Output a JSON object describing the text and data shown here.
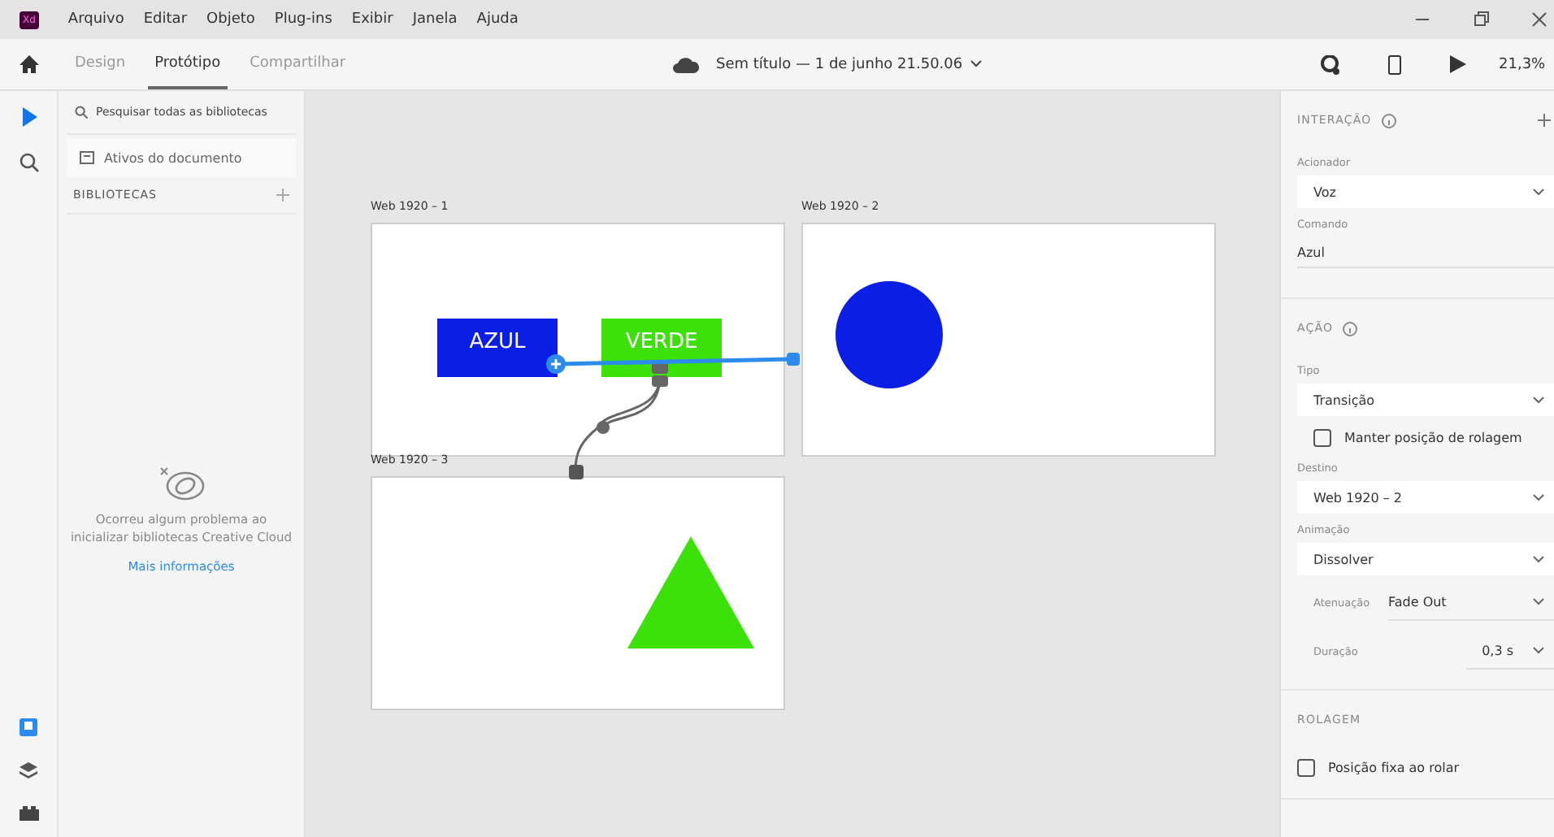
{
  "app_logo": "Xd",
  "menu": [
    "Arquivo",
    "Editar",
    "Objeto",
    "Plug-ins",
    "Exibir",
    "Janela",
    "Ajuda"
  ],
  "tabs": [
    {
      "label": "Design",
      "selected": false
    },
    {
      "label": "Protótipo",
      "selected": true
    },
    {
      "label": "Compartilhar",
      "selected": false
    }
  ],
  "document_title": "Sem título — 1 de junho 21.50.06",
  "zoom": "21,3%",
  "libraries_panel": {
    "search": {
      "placeholder": "Pesquisar todas as bibliotecas"
    },
    "assets_item": "Ativos do documento",
    "heading": "BIBLIOTECAS",
    "error_message": "Ocorreu algum problema ao inicializar bibliotecas Creative Cloud",
    "link": "Mais informações"
  },
  "artboards": [
    {
      "name": "Web 1920 – 1",
      "elements": [
        {
          "kind": "button",
          "label": "AZUL",
          "color": "#0a1ee6"
        },
        {
          "kind": "button",
          "label": "VERDE",
          "color": "#3ce10a"
        }
      ]
    },
    {
      "name": "Web 1920 – 2",
      "elements": [
        {
          "kind": "circle",
          "color": "#0a1ee6"
        }
      ]
    },
    {
      "name": "Web 1920 – 3",
      "elements": [
        {
          "kind": "triangle",
          "color": "#3ce10a"
        }
      ]
    }
  ],
  "interaction": {
    "heading": "INTERAÇÃO",
    "trigger_label": "Acionador",
    "trigger": "Voz",
    "command_label": "Comando",
    "command": "Azul"
  },
  "action": {
    "heading": "AÇÃO",
    "type_label": "Tipo",
    "type": "Transição",
    "keep_scroll": {
      "label": "Manter posição de rolagem",
      "checked": false
    },
    "destination_label": "Destino",
    "destination": "Web 1920 – 2",
    "animation_label": "Animação",
    "animation": "Dissolver",
    "easing_label": "Atenuação",
    "easing": "Fade Out",
    "duration_label": "Duração",
    "duration": "0,3 s"
  },
  "scrolling": {
    "heading": "ROLAGEM",
    "fixed": {
      "label": "Posição fixa ao rolar",
      "checked": false
    }
  }
}
